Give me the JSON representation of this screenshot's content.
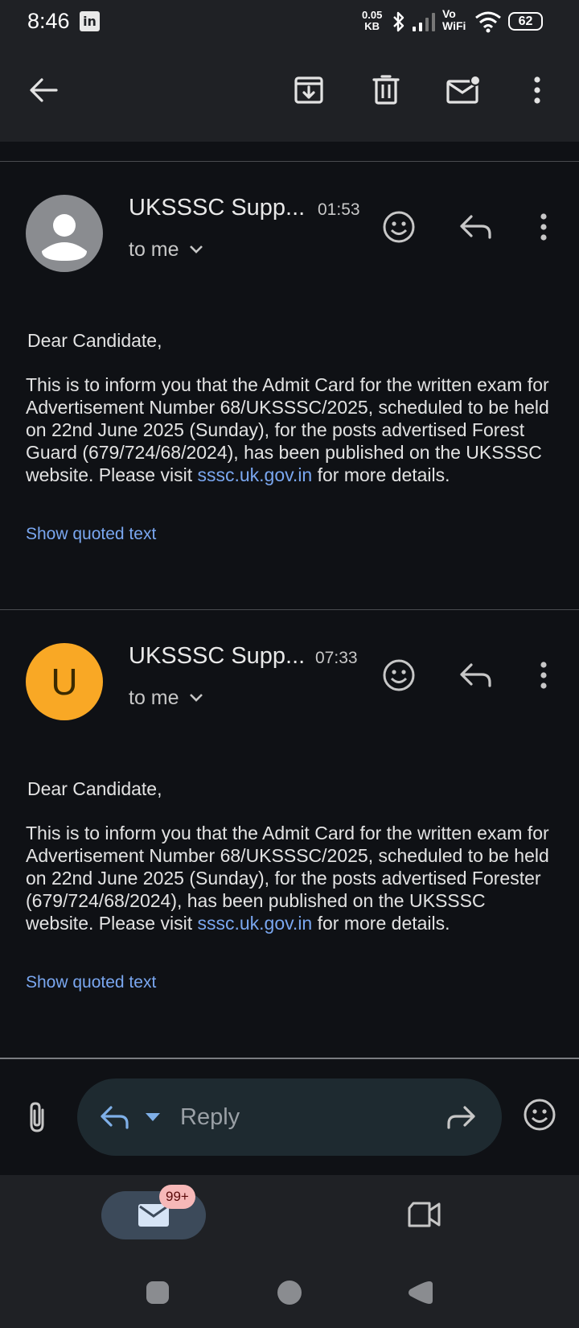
{
  "status_bar": {
    "time": "8:46",
    "app_icon": "linkedin-icon",
    "net_speed_value": "0.05",
    "net_speed_unit": "KB",
    "vowifi_line1": "Vo",
    "vowifi_line2": "WiFi",
    "battery": "62"
  },
  "toolbar": {
    "icons": [
      "back-arrow-icon",
      "archive-icon",
      "delete-icon",
      "mark-unread-icon",
      "more-vert-icon"
    ]
  },
  "messages": [
    {
      "sender": "UKSSSC Supp...",
      "time": "01:53",
      "recipient": "to me",
      "avatar_initial": "",
      "avatar_color": "#8a8c90",
      "greeting": "Dear Candidate,",
      "body_before_link": "This is to inform you that the Admit Card for the written exam for Advertisement Number 68/UKSSSC/2025, scheduled to be held on 22nd June 2025 (Sunday), for the posts advertised Forest Guard (679/724/68/2024), has been published on the UKSSSC website. Please visit ",
      "link": "sssc.uk.gov.in",
      "body_after_link": " for more details.",
      "show_quoted": "Show quoted text"
    },
    {
      "sender": "UKSSSC Supp...",
      "time": "07:33",
      "recipient": "to me",
      "avatar_initial": "U",
      "avatar_color": "#f9a825",
      "greeting": "Dear Candidate,",
      "body_before_link": "This is to inform you that the Admit Card for the written exam for Advertisement Number 68/UKSSSC/2025, scheduled to be held on 22nd June 2025 (Sunday), for the posts advertised Forester (679/724/68/2024), has been published on the UKSSSC website. Please visit ",
      "link": "sssc.uk.gov.in",
      "body_after_link": " for more details.",
      "show_quoted": "Show quoted text"
    }
  ],
  "reply_bar": {
    "placeholder": "Reply"
  },
  "bottom_nav": {
    "mail_badge": "99+"
  },
  "colors": {
    "background": "#0f1115",
    "surface": "#1f2125",
    "link": "#7aa7f0",
    "avatar_orange": "#f9a825"
  }
}
